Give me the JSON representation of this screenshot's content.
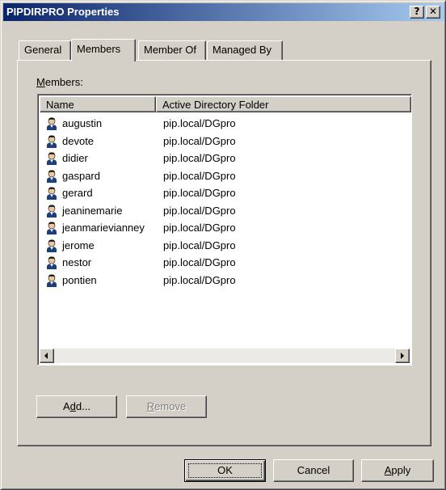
{
  "window": {
    "title": "PIPDIRPRO Properties",
    "help_glyph": "?",
    "close_glyph": "✕"
  },
  "tabs": [
    {
      "label": "General"
    },
    {
      "label": "Members",
      "active": true
    },
    {
      "label": "Member Of"
    },
    {
      "label": "Managed By"
    }
  ],
  "members": {
    "label": "Members:",
    "label_mnemonic": "M",
    "label_rest": "embers:",
    "columns": [
      "Name",
      "Active Directory Folder"
    ],
    "rows": [
      {
        "name": "augustin",
        "folder": "pip.local/DGpro",
        "icon": "user-icon"
      },
      {
        "name": "devote",
        "folder": "pip.local/DGpro",
        "icon": "user-icon"
      },
      {
        "name": "didier",
        "folder": "pip.local/DGpro",
        "icon": "user-icon"
      },
      {
        "name": "gaspard",
        "folder": "pip.local/DGpro",
        "icon": "user-icon"
      },
      {
        "name": "gerard",
        "folder": "pip.local/DGpro",
        "icon": "user-icon"
      },
      {
        "name": "jeaninemarie",
        "folder": "pip.local/DGpro",
        "icon": "user-icon"
      },
      {
        "name": "jeanmarievianney",
        "folder": "pip.local/DGpro",
        "icon": "user-icon"
      },
      {
        "name": "jerome",
        "folder": "pip.local/DGpro",
        "icon": "user-icon"
      },
      {
        "name": "nestor",
        "folder": "pip.local/DGpro",
        "icon": "user-icon"
      },
      {
        "name": "pontien",
        "folder": "pip.local/DGpro",
        "icon": "user-icon"
      }
    ]
  },
  "buttons": {
    "add_pre": "A",
    "add_mn": "d",
    "add_post": "d...",
    "remove_mn": "R",
    "remove_post": "emove",
    "ok": "OK",
    "cancel": "Cancel",
    "apply_mn": "A",
    "apply_post": "pply"
  },
  "colors": {
    "title_start": "#0a246a",
    "title_end": "#a6caf0",
    "face": "#d4d0c8"
  }
}
